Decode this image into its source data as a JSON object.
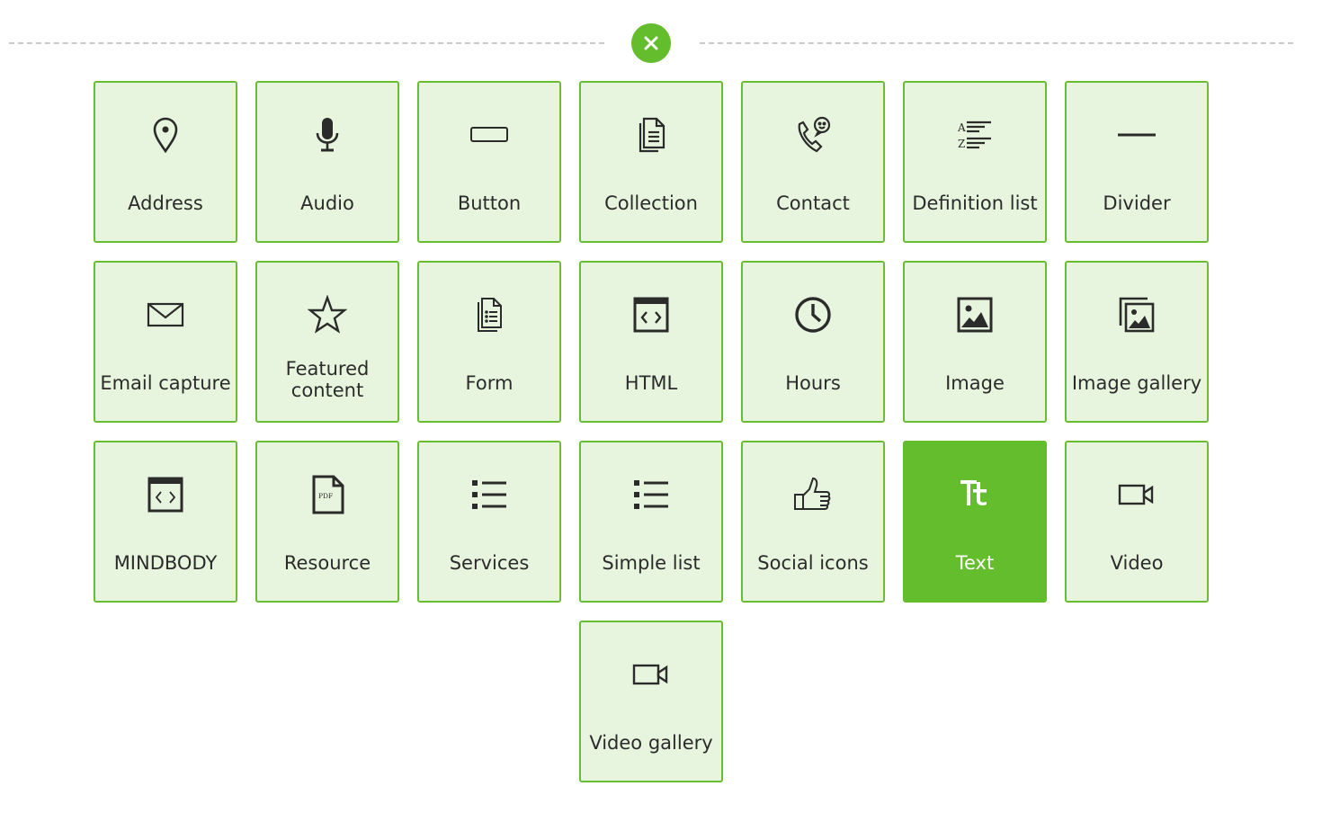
{
  "toolbar": {
    "close_icon": "close-icon",
    "accent_color": "#64bd2c"
  },
  "blocks": [
    {
      "label": "Address",
      "icon": "map-pin-icon"
    },
    {
      "label": "Audio",
      "icon": "microphone-icon"
    },
    {
      "label": "Button",
      "icon": "button-icon"
    },
    {
      "label": "Collection",
      "icon": "documents-icon"
    },
    {
      "label": "Contact",
      "icon": "phone-chat-icon"
    },
    {
      "label": "Definition list",
      "icon": "definition-list-icon"
    },
    {
      "label": "Divider",
      "icon": "horizontal-line-icon"
    },
    {
      "label": "Email capture",
      "icon": "envelope-icon"
    },
    {
      "label": "Featured\ncontent",
      "icon": "star-icon"
    },
    {
      "label": "Form",
      "icon": "form-document-icon"
    },
    {
      "label": "HTML",
      "icon": "code-window-icon"
    },
    {
      "label": "Hours",
      "icon": "clock-icon"
    },
    {
      "label": "Image",
      "icon": "image-icon"
    },
    {
      "label": "Image gallery",
      "icon": "image-gallery-icon"
    },
    {
      "label": "MINDBODY",
      "icon": "code-window-icon"
    },
    {
      "label": "Resource",
      "icon": "pdf-file-icon"
    },
    {
      "label": "Services",
      "icon": "bullet-list-icon"
    },
    {
      "label": "Simple list",
      "icon": "bullet-list-icon"
    },
    {
      "label": "Social icons",
      "icon": "thumbs-up-icon"
    },
    {
      "label": "Text",
      "icon": "text-size-icon",
      "selected": true
    },
    {
      "label": "Video",
      "icon": "video-camera-icon"
    },
    {
      "label": "Video gallery",
      "icon": "video-camera-icon"
    }
  ],
  "colors": {
    "tile_bg": "#e8f5de",
    "tile_border": "#69bd35",
    "selected_bg": "#64bd2c",
    "icon": "#2b2b2b"
  }
}
